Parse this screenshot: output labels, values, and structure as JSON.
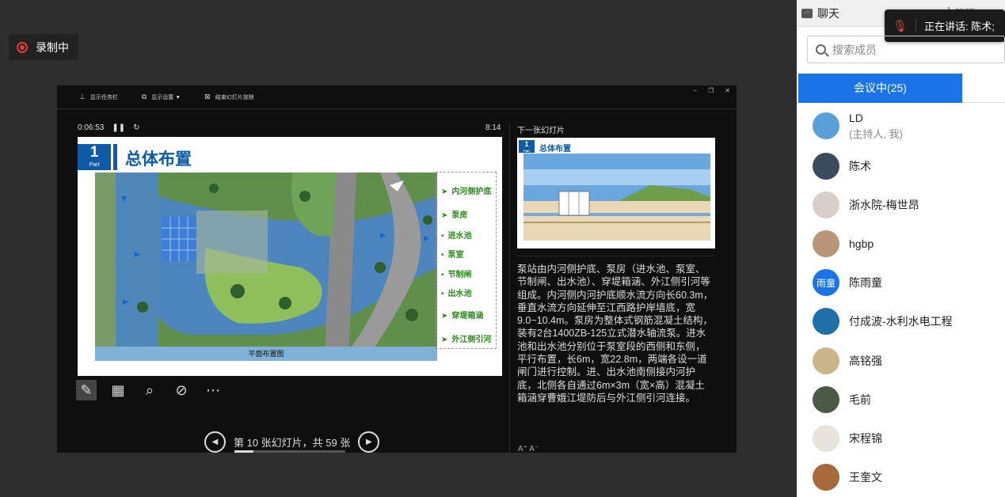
{
  "recording": {
    "label": "录制中"
  },
  "presenter": {
    "toolbar": {
      "taskbar": "显示任务栏",
      "display_settings": "显示设置 ▼",
      "end_show": "结束幻灯片放映"
    },
    "elapsed": "0:06:53",
    "clock": "8:14",
    "slide": {
      "part_number": "1",
      "part_label": "Part",
      "title": "总体布置",
      "map_caption": "平面布置图",
      "legend": [
        "内河侧护底",
        "泵房",
        "进水池",
        "泵室",
        "节制闸",
        "出水池",
        "穿堤箱涵",
        "外江侧引河"
      ]
    },
    "next_slide_label": "下一张幻灯片",
    "next_slide": {
      "part_number": "1",
      "part_label": "Part",
      "title": "总体布置"
    },
    "notes": "泵站由内河侧护底、泵房（进水池、泵室、节制闸、出水池）、穿堤箱涵、外江侧引河等组成。内河侧内河护底顺水流方向长60.3m，垂直水流方向延伸至江西路护岸墙底，宽9.0~10.4m。泵房为整体式钢筋混凝土结构，装有2台1400ZB-125立式潜水轴流泵。进水池和出水池分别位于泵室段的西侧和东侧，平行布置，长6m，宽22.8m，两端各设一道闸门进行控制。进、出水池南侧接内河护底，北侧各自通过6m×3m（宽×高）混凝土箱涵穿曹娥江堤防后与外江侧引河连接。",
    "navigation": {
      "text": "第 10 张幻灯片，共 59 张",
      "current": 10,
      "total": 59
    },
    "font_controls": "A⁺ A⁻"
  },
  "sidebar": {
    "chat_tab": "聊天",
    "second_tab": "┃ 管理",
    "speaking": "正在讲话: 陈术;",
    "search_placeholder": "搜索成员",
    "meeting_tab": "会议中(25)",
    "members": [
      {
        "name": "LD",
        "sub": "(主持人, 我)",
        "avatar_color": "#5aa0d8"
      },
      {
        "name": "陈术",
        "avatar_color": "#3b4b5e"
      },
      {
        "name": "浙水院-梅世昂",
        "avatar_color": "#d8d0c8"
      },
      {
        "name": "hgbp",
        "avatar_color": "#b8967a"
      },
      {
        "name": "陈雨童",
        "avatar_text": "雨童",
        "avatar_color": "#1a74e8"
      },
      {
        "name": "付成波-水利水电工程",
        "avatar_color": "#1f6fa8"
      },
      {
        "name": "高铭强",
        "avatar_color": "#c8b58a"
      },
      {
        "name": "毛前",
        "avatar_color": "#4a5a44"
      },
      {
        "name": "宋程锦",
        "avatar_color": "#e8e4dc"
      },
      {
        "name": "王奎文",
        "avatar_color": "#a86a3a"
      }
    ]
  }
}
